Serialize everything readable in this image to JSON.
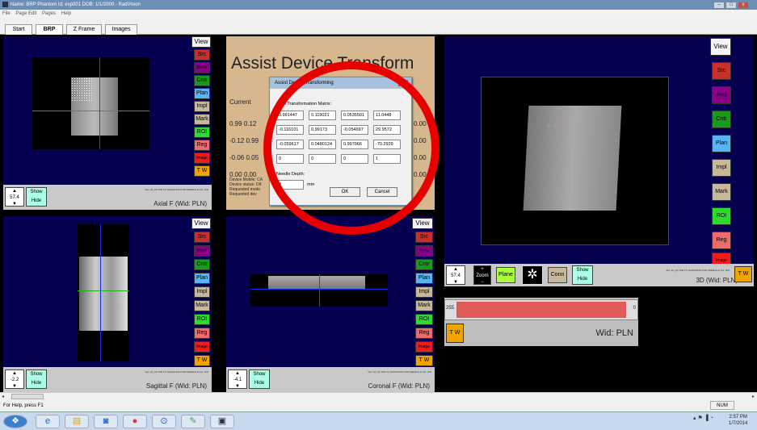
{
  "titlebar": {
    "text": "Name: BRP Phantom   Id: exp001   DOB: 1/1/2000 - RadVision"
  },
  "menu": [
    "File",
    "Page Edit",
    "Pages",
    "Help"
  ],
  "tabs": [
    "Start",
    "BRP",
    "Z Frame",
    "Images"
  ],
  "side_buttons": {
    "view": "View",
    "src": "Src",
    "blend": "Blend",
    "cntr": "Cntr",
    "plan": "Plan",
    "impl": "Impl",
    "mark": "Mark",
    "roi": "ROI",
    "reg": "Reg",
    "image": "Image",
    "tw": "T W"
  },
  "colors": {
    "src": "#c8302c",
    "blend": "#8a008a",
    "cntr": "#1a9a1a",
    "plan": "#58b4f2",
    "impl": "#c7b89c",
    "mark": "#c7b89c",
    "roi": "#2cdc2c",
    "reg": "#ec6b6b",
    "image": "#f01c1c",
    "tw": "#f0a400",
    "pane_bg": "#050050",
    "panel_bg": "#d7b88e",
    "showhide": "#aaffe6",
    "plane": "#a8ff3c",
    "window_bar": "#e05a5a",
    "highlight_ring": "#e80000"
  },
  "panes": {
    "axial": {
      "caption": "Axial F (Wid: PLN)",
      "spin": "57.4",
      "tiny": "Ser: 10_AX T2E TO GUIDANCE FOR NEEDLE at F.H. HSI"
    },
    "sagittal": {
      "caption": "Sagittal F (Wid: PLN)",
      "spin": "-2.2",
      "tiny": "Ser: 10_AX T2E TO GUIDANCE FOR NEEDLE at F.H. HSI"
    },
    "coronal": {
      "caption": "Coronal F (Wid: PLN)",
      "spin": "-4.1",
      "tiny": "Ser: 10_AX T2E TO GUIDANCE FOR NEEDLE at F.H. HSI"
    },
    "threed": {
      "caption": "3D (Wid: PLN)",
      "spin": "57.4",
      "tiny": "Ser: 10_AX T2E TO GUIDANCE FOR NEEDLE at F.H. HSI"
    }
  },
  "show_label": "Show",
  "hide_label": "Hide",
  "zoom_label": "Zoom",
  "plane_label": "Plane",
  "conn_label": "Conn",
  "window_panel": {
    "left_value": "255",
    "right_value": "0",
    "caption": "Wid: PLN",
    "tw": "T W"
  },
  "assist_panel": {
    "title": "Assist Device Transform",
    "current_label": "Current",
    "rows": [
      [
        "0.99",
        "0.12"
      ],
      [
        "-0.12",
        "0.99"
      ],
      [
        "-0.06",
        "0.05"
      ],
      [
        "0.00",
        "0.00"
      ]
    ],
    "right_vals": [
      "0.00",
      "0.00",
      "0.00",
      "0.00"
    ],
    "device_lines": [
      "Device Mobile: CA",
      "Device status: OK",
      "Requested mode",
      "Requested dev"
    ]
  },
  "dialog": {
    "title": "Assist Device Transforming",
    "matrix_label": "4 x 4 Transformation Matrix:",
    "matrix": [
      [
        "0.991447",
        "0.119021",
        "0.0535501",
        "11.0448"
      ],
      [
        "-0.116101",
        "0.99173",
        "-0.054697",
        "29.9572"
      ],
      [
        "-0.059617",
        "0.0480124",
        "0.997066",
        "-70.2929"
      ],
      [
        "0",
        "0",
        "0",
        "1"
      ]
    ],
    "needle_label": "Needle Depth:",
    "needle_value": "0",
    "unit": "mm",
    "ok": "OK",
    "cancel": "Cancel"
  },
  "statusbar": {
    "help": "For Help, press F1",
    "num": "NUM"
  },
  "taskbar": {
    "time": "2:57 PM",
    "date": "1/7/2014"
  }
}
